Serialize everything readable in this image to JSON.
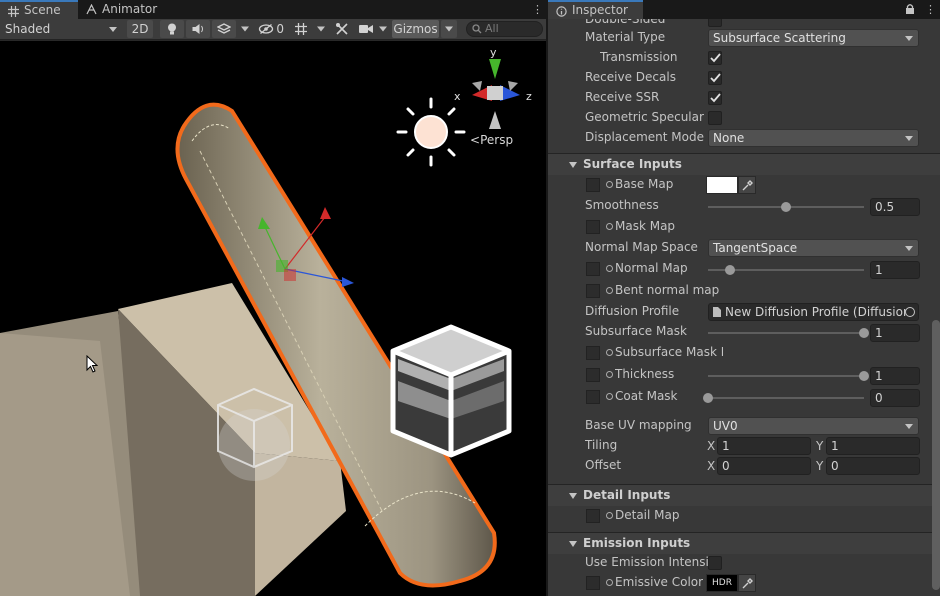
{
  "scene_tabs": {
    "scene_label": "Scene",
    "animator_label": "Animator"
  },
  "scene_toolbar": {
    "shading_mode": "Shaded",
    "mode_2d_label": "2D",
    "hidden_count": "0",
    "gizmos_label": "Gizmos",
    "search_placeholder": "All"
  },
  "viewport": {
    "axis_x": "x",
    "axis_y": "y",
    "axis_z": "z",
    "projection_label": "Persp"
  },
  "inspector": {
    "tab_label": "Inspector",
    "top_rows": {
      "double_sided_label": "Double-Sided",
      "material_type_label": "Material Type",
      "material_type_value": "Subsurface Scattering",
      "transmission_label": "Transmission",
      "receive_decals_label": "Receive Decals",
      "receive_ssr_label": "Receive SSR",
      "geometric_specular_label": "Geometric Specular A",
      "displacement_mode_label": "Displacement Mode",
      "displacement_mode_value": "None"
    },
    "surface_inputs": {
      "header": "Surface Inputs",
      "base_map_label": "Base Map",
      "smoothness_label": "Smoothness",
      "smoothness_value": "0.5",
      "mask_map_label": "Mask Map",
      "normal_map_space_label": "Normal Map Space",
      "normal_map_space_value": "TangentSpace",
      "normal_map_label": "Normal Map",
      "normal_map_value": "1",
      "bent_normal_label": "Bent normal map",
      "diffusion_profile_label": "Diffusion Profile",
      "diffusion_profile_value": "New Diffusion Profile (Diffusion",
      "subsurface_mask_label": "Subsurface Mask",
      "subsurface_mask_value": "1",
      "subsurface_mask_map_label": "Subsurface Mask M",
      "thickness_label": "Thickness",
      "thickness_value": "1",
      "coat_mask_label": "Coat Mask",
      "coat_mask_value": "0",
      "base_uv_label": "Base UV mapping",
      "base_uv_value": "UV0",
      "tiling_label": "Tiling",
      "tiling_x": "1",
      "tiling_y": "1",
      "offset_label": "Offset",
      "offset_x": "0",
      "offset_y": "0",
      "x_label": "X",
      "y_label": "Y"
    },
    "detail_inputs": {
      "header": "Detail Inputs",
      "detail_map_label": "Detail Map"
    },
    "emission_inputs": {
      "header": "Emission Inputs",
      "use_emission_label": "Use Emission Intensity",
      "emissive_color_label": "Emissive Color",
      "hdr_label": "HDR"
    }
  },
  "sliders": {
    "smoothness": 0.5,
    "normal_map": 0.14,
    "subsurface_mask": 1.0,
    "thickness": 1.0,
    "coat_mask": 0.0
  },
  "colors": {
    "selection_outline": "#f26a1b",
    "axis_x": "#d22a2a",
    "axis_y": "#46b52c",
    "axis_z": "#2a56d8",
    "accent_tab": "#3a79bb"
  }
}
